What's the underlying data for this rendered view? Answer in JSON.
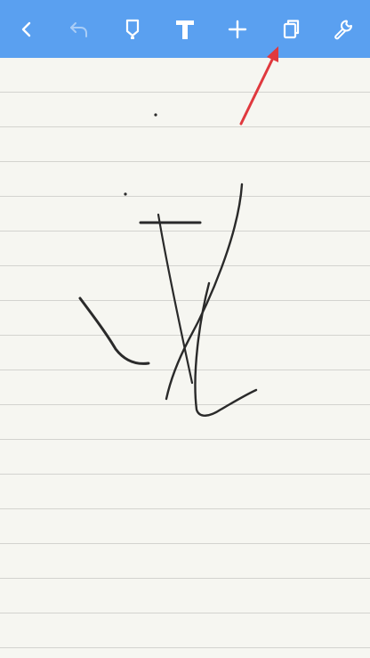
{
  "toolbar": {
    "background": "#5aa0f0",
    "buttons": [
      {
        "id": "back",
        "icon": "chevron-left-icon",
        "enabled": true
      },
      {
        "id": "undo",
        "icon": "undo-icon",
        "enabled": false
      },
      {
        "id": "pen",
        "icon": "pen-tool-icon",
        "enabled": true
      },
      {
        "id": "text",
        "icon": "text-tool-icon",
        "enabled": true
      },
      {
        "id": "add",
        "icon": "plus-icon",
        "enabled": true
      },
      {
        "id": "pages",
        "icon": "copy-pages-icon",
        "enabled": true
      },
      {
        "id": "settings",
        "icon": "wrench-icon",
        "enabled": true
      }
    ]
  },
  "canvas": {
    "paper_color": "#f6f6f1",
    "rule_color": "#d3d3cf",
    "ink_color": "#2a2a2a"
  },
  "annotation": {
    "arrow_color": "#e0393e",
    "points_to": "pages"
  }
}
